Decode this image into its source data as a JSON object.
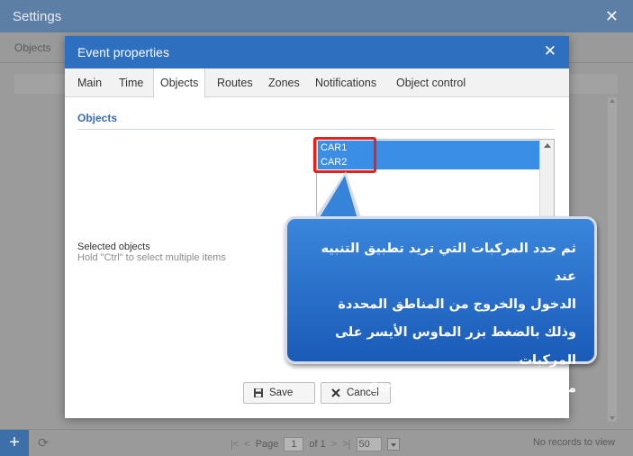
{
  "settings": {
    "title": "Settings",
    "close_symbol": "✕",
    "tab_objects": "Objects",
    "footer": {
      "add_symbol": "+",
      "refresh_symbol": "⟳",
      "first_symbol": "|<",
      "prev_symbol": "<",
      "page_label": "Page",
      "page_value": "1",
      "of_label": "of 1",
      "next_symbol": ">",
      "last_symbol": ">|",
      "page_size": "50",
      "no_records": "No records to view"
    }
  },
  "dialog": {
    "title": "Event properties",
    "close_symbol": "✕",
    "tabs": [
      {
        "label": "Main"
      },
      {
        "label": "Time"
      },
      {
        "label": "Objects"
      },
      {
        "label": "Routes"
      },
      {
        "label": "Zones"
      },
      {
        "label": "Notifications"
      },
      {
        "label": "Object control"
      }
    ],
    "active_tab": "Objects",
    "section_title": "Objects",
    "field_label": "Selected objects",
    "field_hint": "Hold \"Ctrl\" to select multiple items",
    "list_items": [
      "CAR1",
      "CAR2"
    ],
    "save_label": "Save",
    "cancel_label": "Cancel"
  },
  "callout": {
    "lines": [
      "ثم حدد المركبات التي تريد تطبيق التنبيه عند",
      "الدخول والخروج من المناطق المحددة",
      "وذلك بالضغط بزر الماوس الأيسر على المركبات",
      "مع الضغط من الكيبورد على Ctrl"
    ]
  },
  "colors": {
    "dialog_header": "#2f6fbf",
    "selected_item": "#3a8ee6",
    "highlight_border": "#e8201a",
    "section_title": "#3a6db3",
    "callout_fill": "#2a72cc"
  }
}
